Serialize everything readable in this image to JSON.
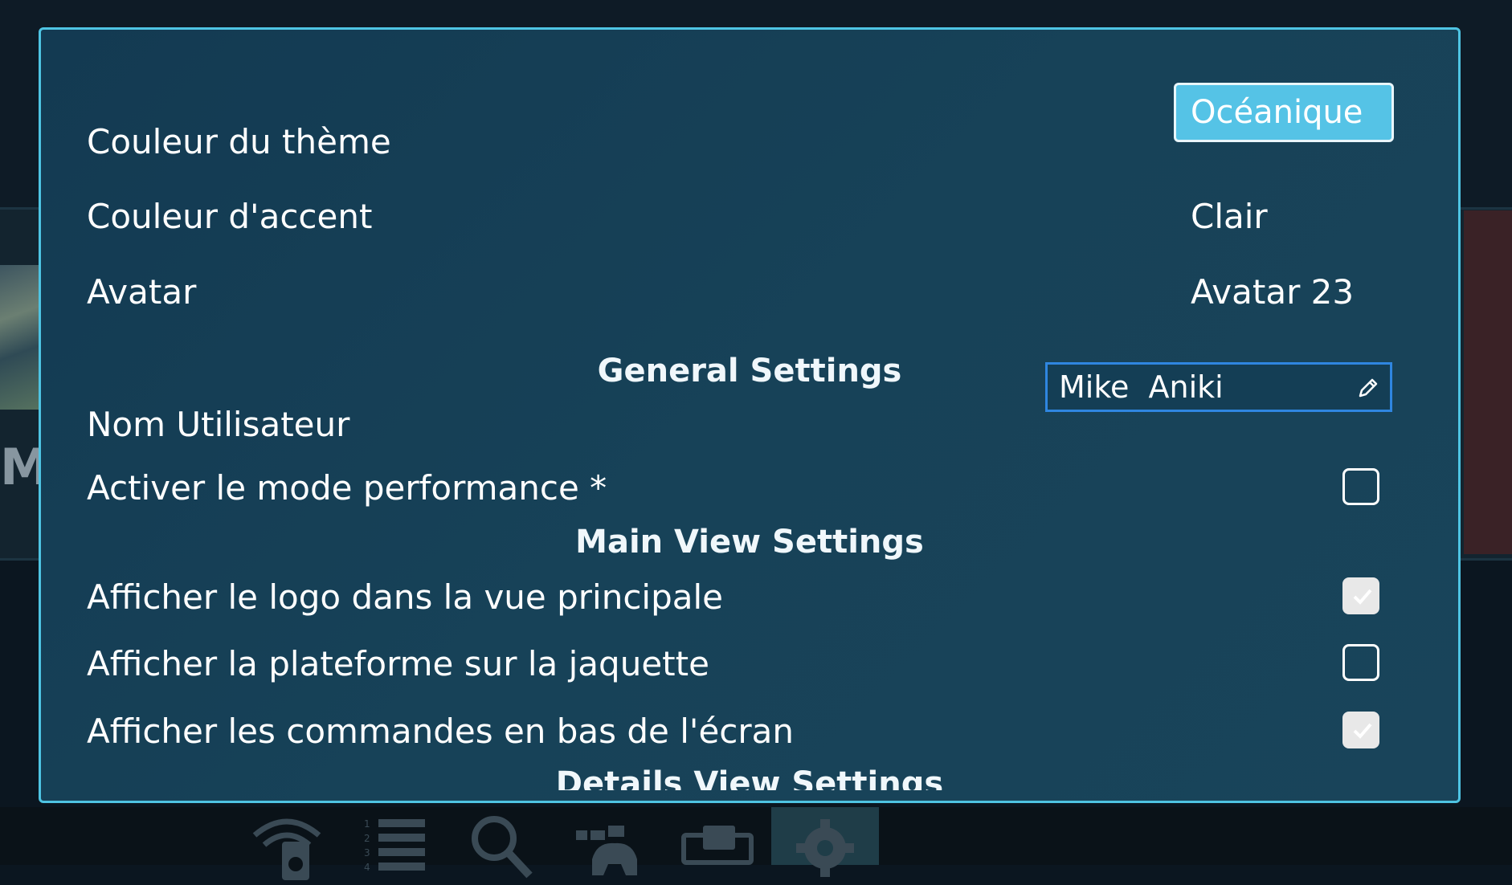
{
  "dialog": {
    "rows": [
      {
        "label": "Couleur du thème",
        "value": "Océanique",
        "control": "button"
      },
      {
        "label": "Couleur d'accent",
        "value": "Clair",
        "control": "selector"
      },
      {
        "label": "Avatar",
        "value": "Avatar 23",
        "control": "selector"
      }
    ],
    "sections": {
      "general": "General Settings",
      "main_view": "Main View Settings",
      "details_view": "Details View Settings"
    },
    "username": {
      "label": "Nom Utilisateur",
      "value": "Mike  Aniki",
      "edit_icon": "pencil-icon"
    },
    "checkbox_rows": [
      {
        "label": "Activer le mode performance *",
        "checked": false
      },
      {
        "label": "Afficher le logo dans la vue principale",
        "checked": true
      },
      {
        "label": "Afficher la plateforme sur la jaquette",
        "checked": false
      },
      {
        "label": "Afficher les commandes en bas de l'écran",
        "checked": true
      }
    ]
  },
  "taskbar": {
    "icons": [
      "network-storage-icon",
      "numbered-list-icon",
      "search-icon",
      "controller-icon",
      "display-icon",
      "gear-icon"
    ],
    "active": "gear-icon"
  },
  "colors": {
    "dialog_border": "#4ec4e3",
    "dialog_bg": "#174258",
    "accent_button": "#55c3e6",
    "input_border": "#2f86e0"
  }
}
